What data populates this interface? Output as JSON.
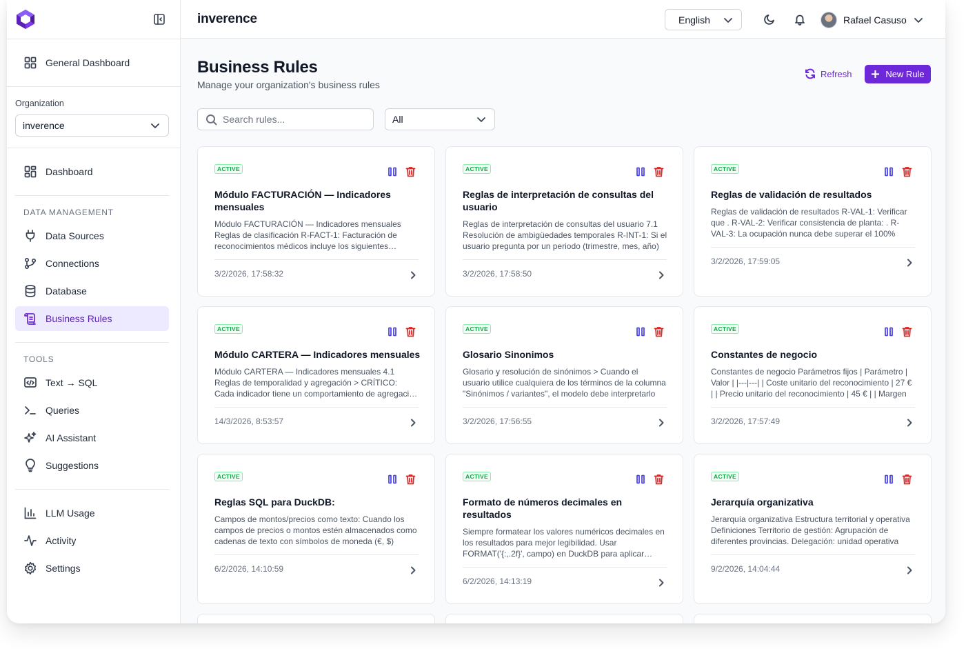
{
  "app": {
    "brand": "inverence",
    "language": "English",
    "user_name": "Rafael Casuso",
    "accent_color": "#6d28d9"
  },
  "sidebar": {
    "general_dashboard": "General Dashboard",
    "org_label": "Organization",
    "org_value": "inverence",
    "dashboard": "Dashboard",
    "data_management_label": "DATA MANAGEMENT",
    "data_sources": "Data Sources",
    "connections": "Connections",
    "database": "Database",
    "business_rules": "Business Rules",
    "tools_label": "TOOLS",
    "text_sql": "Text → SQL",
    "queries": "Queries",
    "ai_assistant": "AI Assistant",
    "suggestions": "Suggestions",
    "llm_usage": "LLM Usage",
    "activity": "Activity",
    "settings": "Settings"
  },
  "page": {
    "title": "Business Rules",
    "subtitle": "Manage your organization's business rules",
    "refresh": "Refresh",
    "new_rule": "New Rule",
    "search_placeholder": "Search rules...",
    "filter_value": "All"
  },
  "rules": [
    {
      "status": "ACTIVE",
      "title": "Módulo FACTURACIÓN — Indicadores mensuales",
      "description": "Módulo FACTURACIÓN — Indicadores mensuales Reglas de clasificación R-FACT-1: Facturación de reconocimientos médicos incluye los siguientes conceptos y servicios prestados",
      "date": "3/2/2026, 17:58:32"
    },
    {
      "status": "ACTIVE",
      "title": "Reglas de interpretación de consultas del usuario",
      "description": "Reglas de interpretación de consultas del usuario 7.1 Resolución de ambigüedades temporales R-INT-1: Si el usuario pregunta por un periodo (trimestre, mes, año)",
      "date": "3/2/2026, 17:58:50"
    },
    {
      "status": "ACTIVE",
      "title": "Reglas de validación de resultados",
      "description": "Reglas de validación de resultados R-VAL-1: Verificar que . R-VAL-2: Verificar consistencia de planta: . R-VAL-3: La ocupación nunca debe superar el 100%",
      "date": "3/2/2026, 17:59:05"
    },
    {
      "status": "ACTIVE",
      "title": "Módulo CARTERA — Indicadores mensuales",
      "description": "Módulo CARTERA — Indicadores mensuales 4.1 Reglas de temporalidad y agregación > CRÍTICO: Cada indicador tiene un comportamiento de agregación diferente",
      "date": "14/3/2026, 8:53:57"
    },
    {
      "status": "ACTIVE",
      "title": "Glosario Sinonimos",
      "description": "Glosario y resolución de sinónimos > Cuando el usuario utilice cualquiera de los términos de la columna \"Sinónimos / variantes\", el modelo debe interpretarlo",
      "date": "3/2/2026, 17:56:55"
    },
    {
      "status": "ACTIVE",
      "title": "Constantes de negocio",
      "description": "Constantes de negocio Parámetros fijos | Parámetro | Valor | |---|---| | Coste unitario del reconocimiento | 27 € | | Precio unitario del reconocimiento | 45 € | | Margen",
      "date": "3/2/2026, 17:57:49"
    },
    {
      "status": "ACTIVE",
      "title": "Reglas SQL para DuckDB:",
      "description": "Campos de montos/precios como texto: Cuando los campos de precios o montos estén almacenados como cadenas de texto con símbolos de moneda (€, $)",
      "date": "6/2/2026, 14:10:59"
    },
    {
      "status": "ACTIVE",
      "title": "Formato de números decimales en resultados",
      "description": "Siempre formatear los valores numéricos decimales en los resultados para mejor legibilidad. Usar FORMAT('{:,.2f}', campo) en DuckDB para aplicar separadores",
      "date": "6/2/2026, 14:13:19"
    },
    {
      "status": "ACTIVE",
      "title": "Jerarquía organizativa",
      "description": "Jerarquía organizativa Estructura territorial y operativa Definiciones Territorio de gestión: Agrupación de diferentes provincias. Delegación: unidad operativa",
      "date": "9/2/2026, 14:04:44"
    }
  ]
}
